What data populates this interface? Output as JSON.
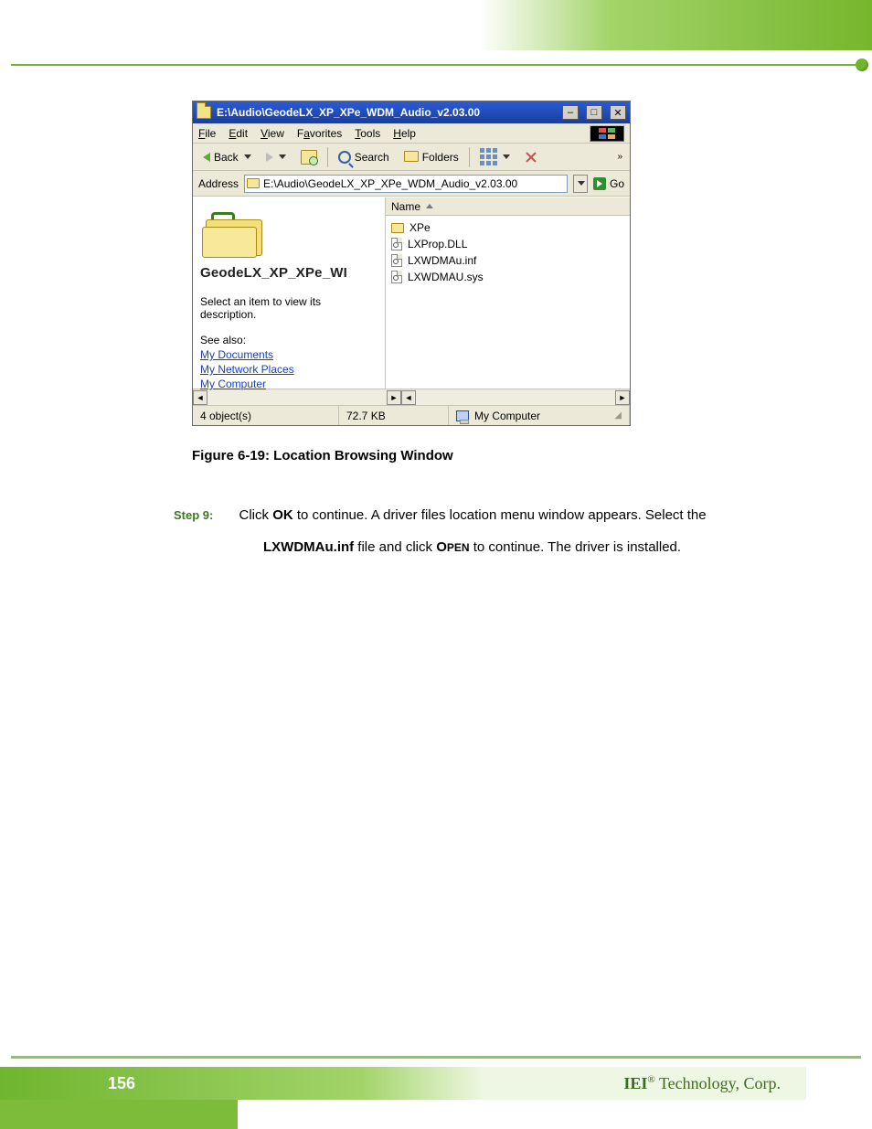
{
  "header": {},
  "explorer": {
    "title": "E:\\Audio\\GeodeLX_XP_XPe_WDM_Audio_v2.03.00",
    "menus": {
      "file": "File",
      "edit": "Edit",
      "view": "View",
      "favorites": "Favorites",
      "tools": "Tools",
      "help": "Help"
    },
    "toolbar": {
      "back": "Back",
      "search": "Search",
      "folders": "Folders"
    },
    "address": {
      "label": "Address",
      "value": "E:\\Audio\\GeodeLX_XP_XPe_WDM_Audio_v2.03.00",
      "go": "Go"
    },
    "left_pane": {
      "title": "GeodeLX_XP_XPe_WI",
      "desc": "Select an item to view its description.",
      "seealso": "See also:",
      "links": [
        "My Documents",
        "My Network Places",
        "My Computer"
      ]
    },
    "right_pane": {
      "column": "Name",
      "items": [
        {
          "type": "folder",
          "name": "XPe"
        },
        {
          "type": "dll",
          "name": "LXProp.DLL"
        },
        {
          "type": "inf",
          "name": "LXWDMAu.inf"
        },
        {
          "type": "sys",
          "name": "LXWDMAU.sys"
        }
      ]
    },
    "status": {
      "objects": "4 object(s)",
      "size": "72.7 KB",
      "location": "My Computer"
    }
  },
  "caption": "Figure 6-19: Location Browsing Window",
  "step": {
    "label": "Step 9:",
    "line1_a": "Click ",
    "line1_b": "OK",
    "line1_c": " to continue. A driver files location menu window appears. Select the",
    "line2_a": "LXWDMAu.inf",
    "line2_b": " file and click ",
    "line2_c": "Open",
    "line2_d": " to continue. The driver is installed."
  },
  "footer": {
    "page": "156",
    "brand_a": "IEI",
    "brand_reg": "®",
    "brand_b": " Technology, Corp."
  }
}
